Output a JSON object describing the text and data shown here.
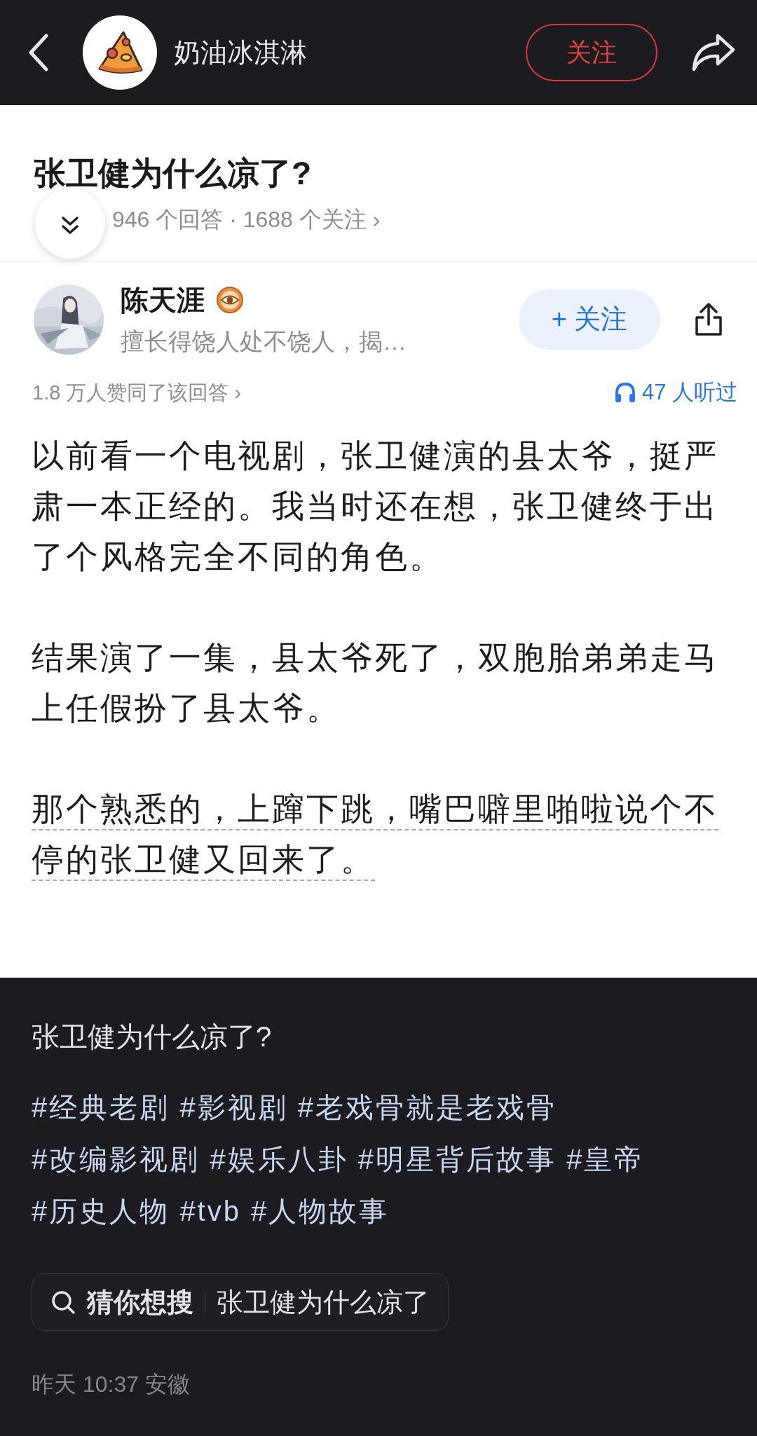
{
  "top_bar": {
    "account_name": "奶油冰淇淋",
    "follow_button": "关注"
  },
  "question": {
    "title": "张卫健为什么凉了?",
    "meta": "946 个回答 · 1688 个关注 ›"
  },
  "author": {
    "name": "陈天涯",
    "bio": "擅长得饶人处不饶人，揭…",
    "follow_button": "+ 关注"
  },
  "stats": {
    "approvals": "1.8 万人赞同了该回答 ›",
    "listeners": "47 人听过"
  },
  "paragraphs": [
    {
      "text": "以前看一个电视剧，张卫健演的县太爷，挺严肃一本正经的。我当时还在想，张卫健终于出了个风格完全不同的角色。",
      "underlined": false
    },
    {
      "text": "结果演了一集，县太爷死了，双胞胎弟弟走马上任假扮了县太爷。",
      "underlined": false
    },
    {
      "text": "那个熟悉的，上蹿下跳，嘴巴噼里啪啦说个不停的张卫健又回来了。",
      "underlined": true
    }
  ],
  "footer": {
    "title": "张卫健为什么凉了?",
    "tags": [
      "#经典老剧",
      "#影视剧",
      "#老戏骨就是老戏骨",
      "#改编影视剧",
      "#娱乐八卦",
      "#明星背后故事",
      "#皇帝",
      "#历史人物",
      "#tvb",
      "#人物故事"
    ],
    "search": {
      "label": "猜你想搜",
      "query": "张卫健为什么凉了"
    },
    "timestamp": "昨天 10:37 安徽"
  }
}
